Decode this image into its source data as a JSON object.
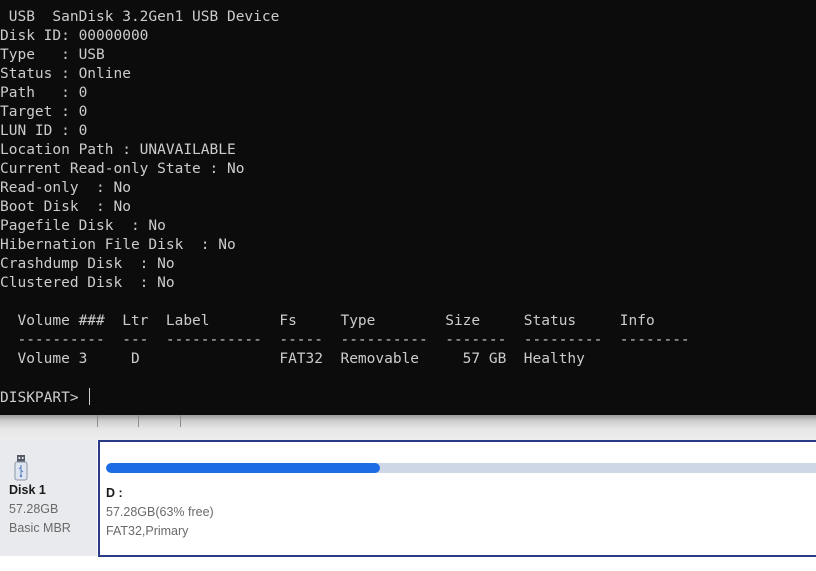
{
  "console": {
    "lines": [
      " USB  SanDisk 3.2Gen1 USB Device",
      "Disk ID: 00000000",
      "Type   : USB",
      "Status : Online",
      "Path   : 0",
      "Target : 0",
      "LUN ID : 0",
      "Location Path : UNAVAILABLE",
      "Current Read-only State : No",
      "Read-only  : No",
      "Boot Disk  : No",
      "Pagefile Disk  : No",
      "Hibernation File Disk  : No",
      "Crashdump Disk  : No",
      "Clustered Disk  : No",
      "",
      "  Volume ###  Ltr  Label        Fs     Type        Size     Status     Info",
      "  ----------  ---  -----------  -----  ----------  -------  ---------  --------",
      "  Volume 3     D                FAT32  Removable     57 GB  Healthy",
      "",
      "DISKPART> "
    ]
  },
  "disk": {
    "icon": "usb-drive-icon",
    "name": "Disk 1",
    "size": "57.28GB",
    "type": "Basic MBR"
  },
  "partition": {
    "letter": "D :",
    "size_free": "57.28GB(63% free)",
    "fs": "FAT32,Primary",
    "used_fraction": 0.37
  },
  "colors": {
    "console_bg": "#0c0c0c",
    "console_text": "#cccccc",
    "usage_fill": "#1d6ce6",
    "usage_track": "#ced7e6",
    "partition_border": "#2b3a86"
  }
}
